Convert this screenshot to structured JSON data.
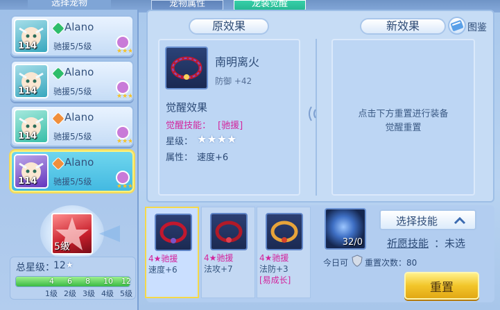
{
  "header": {
    "select_pet": "选择宠物",
    "tab_attr": "宠物属性",
    "tab_awaken": "龙装觉醒"
  },
  "pets": [
    {
      "name": "Alano",
      "support": "驰援5/5级",
      "level": "114",
      "rank_color": "#2ebd6b",
      "selected": false
    },
    {
      "name": "Alano",
      "support": "驰援5/5级",
      "level": "114",
      "rank_color": "#2ebd6b",
      "selected": false
    },
    {
      "name": "Alano",
      "support": "驰援5/5级",
      "level": "114",
      "rank_color": "#f08f3c",
      "selected": false
    },
    {
      "name": "Alano",
      "support": "驰援5/5级",
      "level": "114",
      "rank_color": "#f08f3c",
      "selected": true
    }
  ],
  "orig": {
    "header": "原效果",
    "item_name": "南明离火",
    "item_stat": "防御 +42",
    "awaken_title": "觉醒效果",
    "skill_label": "觉醒技能：",
    "skill_value": "[驰援]",
    "star_label": "星级：",
    "stars": "★★★★",
    "attr_label": "属性：",
    "attr_value": "速度+6"
  },
  "new": {
    "header": "新效果",
    "hint_line1": "点击下方重置进行装备",
    "hint_line2": "觉醒重置",
    "album": "图鉴"
  },
  "pet_skill": {
    "level": "5级"
  },
  "total_star": {
    "label": "总星级：",
    "value": "12",
    "star": "★"
  },
  "progress": {
    "marks": [
      "4",
      "6",
      "8",
      "10",
      "12"
    ],
    "levels": [
      "1级",
      "2级",
      "3级",
      "4级",
      "5级"
    ],
    "fill_fraction": 1.0
  },
  "equips": [
    {
      "t1": "4★驰援",
      "t2": "速度+6",
      "t3": ""
    },
    {
      "t1": "4★驰援",
      "t2": "法攻+7",
      "t3": ""
    },
    {
      "t1": "4★驰援",
      "t2": "法防+3",
      "t3": "[易成长]"
    }
  ],
  "reset": {
    "orb_count": "32/0",
    "today_label": "今日可",
    "reset_times": "重置次数：80",
    "select_skill": "选择技能",
    "wish_label": "祈愿技能",
    "wish_value": "：未选",
    "reset_button": "重置"
  }
}
